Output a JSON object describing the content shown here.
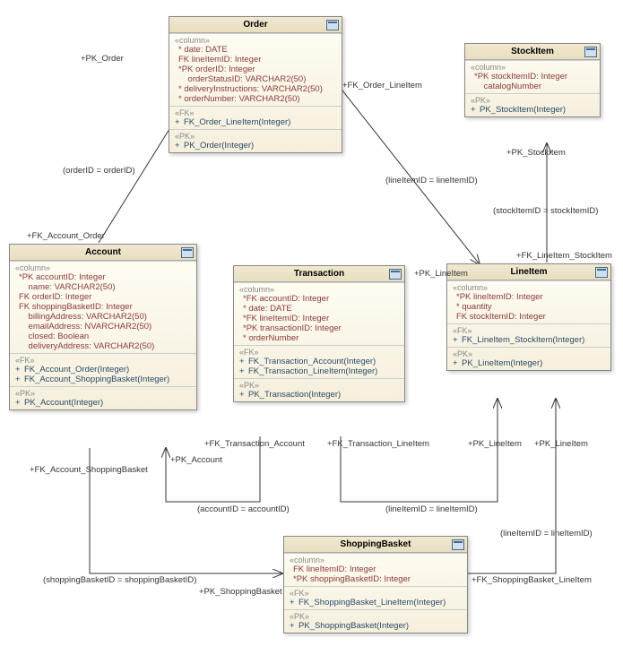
{
  "entities": {
    "order": {
      "title": "Order",
      "stereo": "«column»",
      "columns": [
        {
          "prefix": "*",
          "name": "date:",
          "type": "DATE"
        },
        {
          "prefix": "FK",
          "name": "lineItemID:",
          "type": "Integer"
        },
        {
          "prefix": "*PK",
          "name": "orderID:",
          "type": "Integer"
        },
        {
          "prefix": "",
          "name": "orderStatusID:",
          "type": "VARCHAR2(50)"
        },
        {
          "prefix": "*",
          "name": "deliveryInstructions:",
          "type": "VARCHAR2(50)"
        },
        {
          "prefix": "*",
          "name": "orderNumber:",
          "type": "VARCHAR2(50)"
        }
      ],
      "fkStereo": "«FK»",
      "fks": [
        "FK_Order_LineItem(Integer)"
      ],
      "pkStereo": "«PK»",
      "pks": [
        "PK_Order(Integer)"
      ]
    },
    "stockitem": {
      "title": "StockItem",
      "stereo": "«column»",
      "columns": [
        {
          "prefix": "*PK",
          "name": "stockItemID:",
          "type": "Integer"
        },
        {
          "prefix": "",
          "name": "catalogNumber",
          "type": ""
        }
      ],
      "pkStereo": "«PK»",
      "pks": [
        "PK_StockItem(Integer)"
      ]
    },
    "account": {
      "title": "Account",
      "stereo": "«column»",
      "columns": [
        {
          "prefix": "*PK",
          "name": "accountID:",
          "type": "Integer"
        },
        {
          "prefix": "",
          "name": "name:",
          "type": "VARCHAR2(50)"
        },
        {
          "prefix": "FK",
          "name": "orderID:",
          "type": "Integer"
        },
        {
          "prefix": "FK",
          "name": "shoppingBasketID:",
          "type": "Integer"
        },
        {
          "prefix": "",
          "name": "billingAddress:",
          "type": "VARCHAR2(50)"
        },
        {
          "prefix": "",
          "name": "emailAddress:",
          "type": "NVARCHAR2(50)"
        },
        {
          "prefix": "",
          "name": "closed:",
          "type": "Boolean"
        },
        {
          "prefix": "",
          "name": "deliveryAddress:",
          "type": "VARCHAR2(50)"
        }
      ],
      "fkStereo": "«FK»",
      "fks": [
        "FK_Account_Order(Integer)",
        "FK_Account_ShoppingBasket(Integer)"
      ],
      "pkStereo": "«PK»",
      "pks": [
        "PK_Account(Integer)"
      ]
    },
    "transaction": {
      "title": "Transaction",
      "stereo": "«column»",
      "columns": [
        {
          "prefix": "*FK",
          "name": "accountID:",
          "type": "Integer"
        },
        {
          "prefix": "*",
          "name": "date:",
          "type": "DATE"
        },
        {
          "prefix": "*FK",
          "name": "lineItemID:",
          "type": "Integer"
        },
        {
          "prefix": "*PK",
          "name": "transactionID:",
          "type": "Integer"
        },
        {
          "prefix": "*",
          "name": "orderNumber",
          "type": ""
        }
      ],
      "fkStereo": "«FK»",
      "fks": [
        "FK_Transaction_Account(Integer)",
        "FK_Transaction_LineItem(Integer)"
      ],
      "pkStereo": "«PK»",
      "pks": [
        "PK_Transaction(Integer)"
      ]
    },
    "lineitem": {
      "title": "LineItem",
      "stereo": "«column»",
      "columns": [
        {
          "prefix": "*PK",
          "name": "lineItemID:",
          "type": "Integer"
        },
        {
          "prefix": "*",
          "name": "quantity",
          "type": ""
        },
        {
          "prefix": "FK",
          "name": "stockItemID:",
          "type": "Integer"
        }
      ],
      "fkStereo": "«FK»",
      "fks": [
        "FK_LineItem_StockItem(Integer)"
      ],
      "pkStereo": "«PK»",
      "pks": [
        "PK_LineItem(Integer)"
      ]
    },
    "shoppingbasket": {
      "title": "ShoppingBasket",
      "stereo": "«column»",
      "columns": [
        {
          "prefix": "FK",
          "name": "lineItemID:",
          "type": "Integer"
        },
        {
          "prefix": "*PK",
          "name": "shoppingBasketID:",
          "type": "Integer"
        }
      ],
      "fkStereo": "«FK»",
      "fks": [
        "FK_ShoppingBasket_LineItem(Integer)"
      ],
      "pkStereo": "«PK»",
      "pks": [
        "PK_ShoppingBasket(Integer)"
      ]
    }
  },
  "labels": {
    "pkOrder": "+PK_Order",
    "orderIdEq": "(orderID = orderID)",
    "fkAccountOrder": "+FK_Account_Order",
    "fkOrderLineItem": "+FK_Order_LineItem",
    "lineItemIdEq": "(lineItemID = lineItemID)",
    "pkStockItem": "+PK_StockItem",
    "stockItemIdEq": "(stockItemID = stockItemID)",
    "fkLineItemStockItem": "+FK_LineItem_StockItem",
    "pkLineItem": "+PK_LineItem",
    "fkAccountShoppingBasket": "+FK_Account_ShoppingBasket",
    "pkAccount": "+PK_Account",
    "fkTransactionAccount": "+FK_Transaction_Account",
    "fkTransactionLineItem": "+FK_Transaction_LineItem",
    "accountIdEq": "(accountID = accountID)",
    "lineItemIdEq2": "(lineItemID = lineItemID)",
    "lineItemIdEq3": "(lineItemID = lineItemID)",
    "shoppingBasketIdEq": "(shoppingBasketID = shoppingBasketID)",
    "pkShoppingBasket": "+PK_ShoppingBasket",
    "fkShoppingBasketLineItem": "+FK_ShoppingBasket_LineItem",
    "pkLineItem2": "+PK_LineItem"
  }
}
